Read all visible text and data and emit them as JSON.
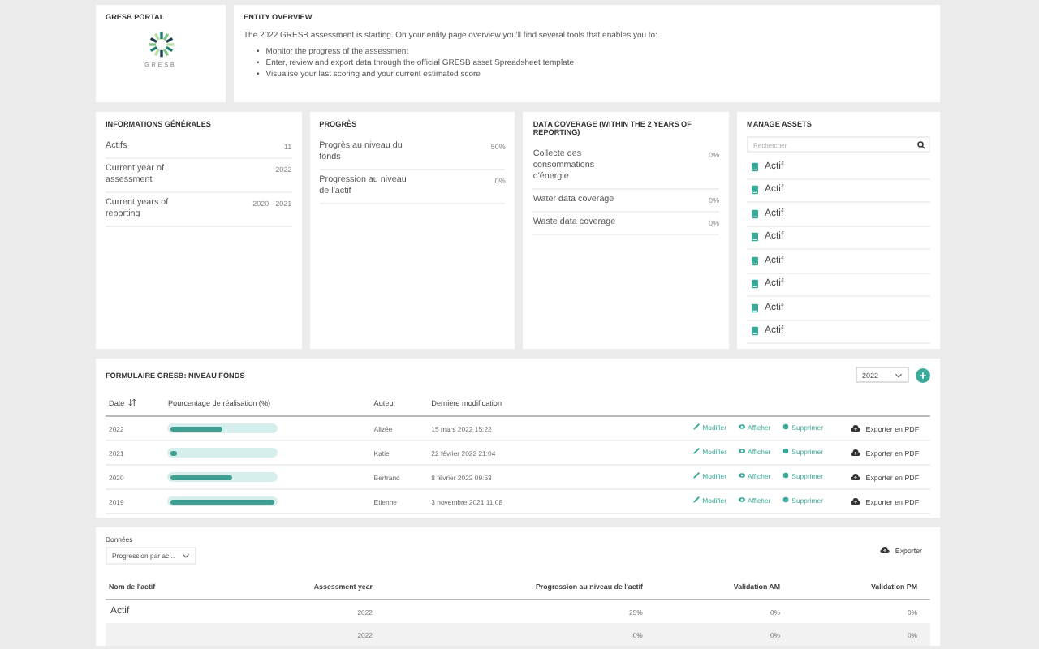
{
  "portal": {
    "title": "GRESB PORTAL",
    "logo_text": "GRESB"
  },
  "overview": {
    "title": "ENTITY OVERVIEW",
    "intro": "The 2022 GRESB assessment is starting. On your entity page overview you'll find several tools that enables you to:",
    "bullets": [
      {
        "marker": "•",
        "text": "Monitor the progress of the assessment"
      },
      {
        "marker": "•",
        "text": "Enter, review and export data through the official GRESB asset Spreadsheet template"
      },
      {
        "marker": "•",
        "text": "Visualise your last scoring and your current estimated score"
      }
    ]
  },
  "general": {
    "title": "INFORMATIONS GÉNÉRALES",
    "rows": [
      {
        "label": "Actifs",
        "value": "11"
      },
      {
        "label": "Current year of assessment",
        "value": "2022"
      },
      {
        "label": "Current years of reporting",
        "value": "2020 - 2021"
      }
    ]
  },
  "progress": {
    "title": "PROGRÈS",
    "rows": [
      {
        "label": "Progrès au niveau du fonds",
        "value": "50%"
      },
      {
        "label": "Progression au niveau de l'actif",
        "value": "0%"
      }
    ]
  },
  "coverage": {
    "title": "DATA COVERAGE (WITHIN THE 2 YEARS OF REPORTING)",
    "rows": [
      {
        "label": "Collecte des consommations d'énergie",
        "value": "0%"
      },
      {
        "label": "Water data coverage",
        "value": "0%"
      },
      {
        "label": "Waste data coverage",
        "value": "0%"
      }
    ]
  },
  "assets": {
    "title": "MANAGE ASSETS",
    "search_placeholder": "Rechercher",
    "items": [
      "Actif",
      "Actif",
      "Actif",
      "Actif",
      "Actif",
      "Actif",
      "Actif",
      "Actif"
    ]
  },
  "form": {
    "title": "FORMULAIRE GRESB: NIVEAU FONDS",
    "year_select": "2022",
    "columns": [
      "Date",
      "Pourcentage de réalisation (%)",
      "Auteur",
      "Dernière modification"
    ],
    "rows": [
      {
        "year": "2022",
        "level": 0.5,
        "author": "Alizée",
        "modified": "15 mars 2022 15:22",
        "actions": [
          "Modifier",
          "Afficher",
          "Supprimer"
        ],
        "export": "Exporter en PDF"
      },
      {
        "year": "2021",
        "level": 0.05,
        "author": "Katie",
        "modified": "22 février 2022 21:04",
        "actions": [
          "Modifier",
          "Afficher",
          "Supprimer"
        ],
        "export": "Exporter en PDF"
      },
      {
        "year": "2020",
        "level": 0.58,
        "author": "Bertrand",
        "modified": "8 février 2022 09:53",
        "actions": [
          "Modifier",
          "Afficher",
          "Supprimer"
        ],
        "export": "Exporter en PDF"
      },
      {
        "year": "2019",
        "level": 1,
        "author": "Etienne",
        "modified": "3 novembre 2021 11:08",
        "actions": [
          "Modifier",
          "Afficher",
          "Supprimer"
        ],
        "export": "Exporter en PDF"
      }
    ]
  },
  "data": {
    "label": "Données",
    "select": "Progression par ac...",
    "export": "Exporter",
    "columns": [
      "Nom de l'actif",
      "Assessment year",
      "Progression au niveau de l'actif",
      "Validation AM",
      "Validation PM"
    ],
    "rows": [
      {
        "cells": [
          "Actif",
          "2022",
          "25%",
          "0%",
          "0%"
        ]
      },
      {
        "cells": [
          "",
          "2022",
          "0%",
          "0%",
          "0%"
        ]
      }
    ]
  }
}
